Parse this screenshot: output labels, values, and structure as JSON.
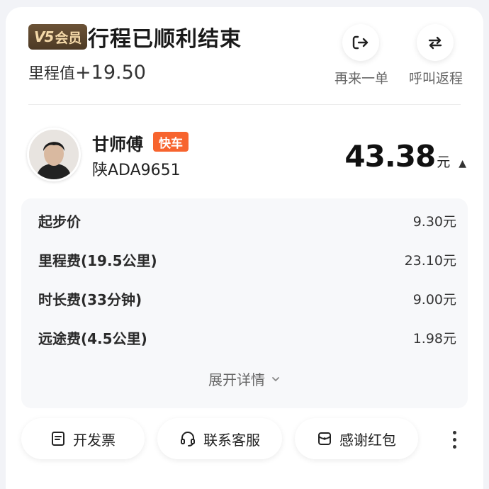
{
  "header": {
    "vip_level": "V5",
    "vip_text": "会员",
    "title": "行程已顺利结束",
    "mileage_label": "里程值",
    "mileage_value": "+19.50"
  },
  "actions": [
    {
      "label": "再来一单",
      "icon": "reorder-icon"
    },
    {
      "label": "呼叫返程",
      "icon": "return-trip-icon"
    }
  ],
  "driver": {
    "name": "甘师傅",
    "car_type": "快车",
    "plate": "陕ADA9651"
  },
  "total": {
    "amount": "43.38",
    "currency": "元",
    "caret": "▲"
  },
  "fees": [
    {
      "name": "起步价",
      "amount": "9.30元"
    },
    {
      "name": "里程费(19.5公里)",
      "amount": "23.10元"
    },
    {
      "name": "时长费(33分钟)",
      "amount": "9.00元"
    },
    {
      "name": "远途费(4.5公里)",
      "amount": "1.98元"
    }
  ],
  "expand_label": "展开详情",
  "bottom_buttons": [
    {
      "label": "开发票",
      "icon": "invoice-icon"
    },
    {
      "label": "联系客服",
      "icon": "headset-icon"
    },
    {
      "label": "感谢红包",
      "icon": "red-envelope-icon"
    }
  ],
  "colors": {
    "accent": "#f7642e",
    "vip_gold": "#f3d8a8",
    "vip_brown": "#5a4530",
    "background": "#f2f3f7"
  }
}
